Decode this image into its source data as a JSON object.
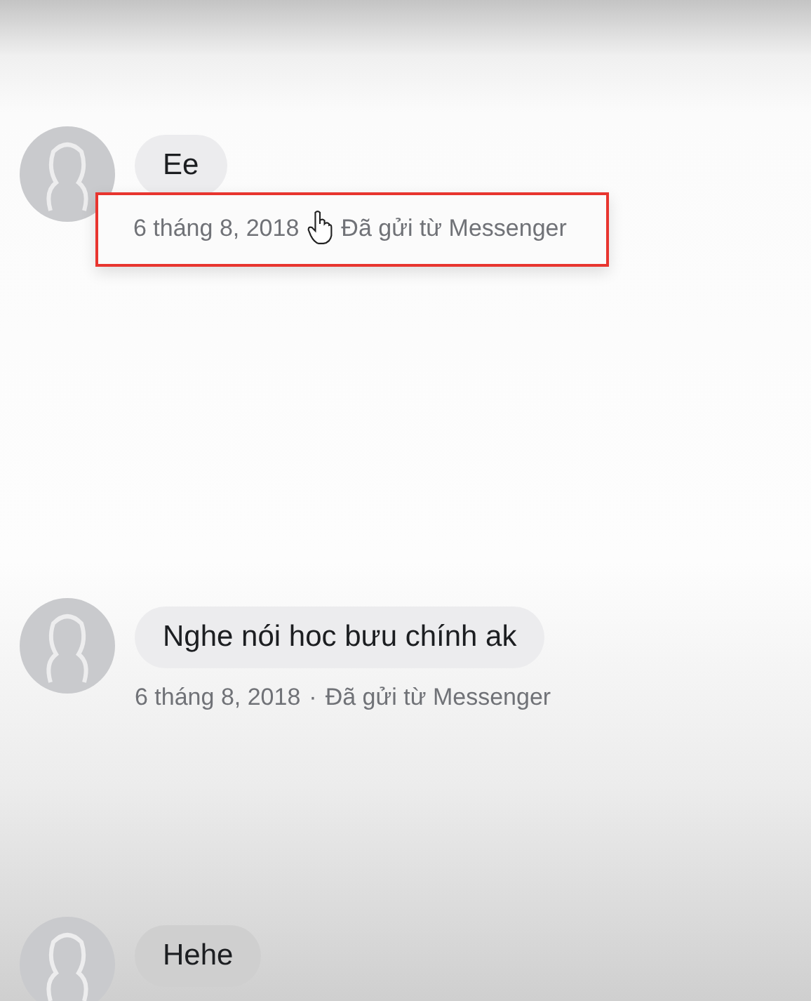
{
  "messages": [
    {
      "text": "Ee",
      "date": "6 tháng 8, 2018",
      "source": "Đã gửi từ Messenger",
      "highlighted": true,
      "cursor": true
    },
    {
      "text": "Nghe nói hoc bưu chính ak",
      "date": "6 tháng 8, 2018",
      "separator": "·",
      "source": "Đã gửi từ Messenger",
      "highlighted": false,
      "cursor": false
    },
    {
      "text": "Hehe",
      "highlighted": false,
      "cursor": false
    }
  ]
}
